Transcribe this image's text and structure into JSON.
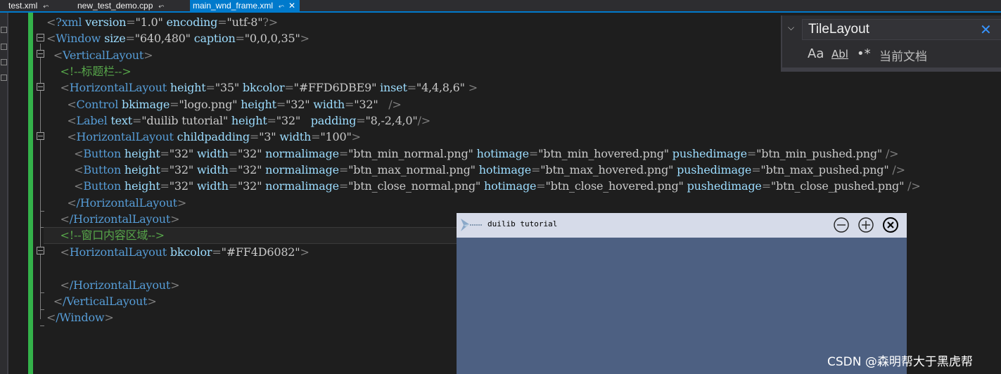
{
  "tabs": [
    {
      "label": "test.xml",
      "pin": "⬿",
      "active": false
    },
    {
      "label": "new_test_demo.cpp",
      "pin": "⬿",
      "active": false
    },
    {
      "label": "main_wnd_frame.xml",
      "pin": "⬿",
      "close": "✕",
      "active": true
    }
  ],
  "code": {
    "xml_decl": {
      "tag": "?xml",
      "a1": "version",
      "v1": "\"1.0\"",
      "a2": "encoding",
      "v2": "\"utf-8\"",
      "end": "?>"
    },
    "window": {
      "tag": "Window",
      "a1": "size",
      "v1": "\"640,480\"",
      "a2": "caption",
      "v2": "\"0,0,0,35\""
    },
    "vlayout_open": "VerticalLayout",
    "comment_title": "<!--标题栏-->",
    "hl_title": {
      "tag": "HorizontalLayout",
      "a1": "height",
      "v1": "\"35\"",
      "a2": "bkcolor",
      "v2": "\"#FFD6DBE9\"",
      "a3": "inset",
      "v3": "\"4,4,8,6\""
    },
    "control": {
      "tag": "Control",
      "a1": "bkimage",
      "v1": "\"logo.png\"",
      "a2": "height",
      "v2": "\"32\"",
      "a3": "width",
      "v3": "\"32\""
    },
    "label": {
      "tag": "Label",
      "a1": "text",
      "v1": "\"duilib tutorial\"",
      "a2": "height",
      "v2": "\"32\"",
      "a3": "padding",
      "v3": "\"8,-2,4,0\""
    },
    "hl_buttons": {
      "tag": "HorizontalLayout",
      "a1": "childpadding",
      "v1": "\"3\"",
      "a2": "width",
      "v2": "\"100\""
    },
    "btn_min": {
      "tag": "Button",
      "a1": "height",
      "v1": "\"32\"",
      "a2": "width",
      "v2": "\"32\"",
      "a3": "normalimage",
      "v3": "\"btn_min_normal.png\"",
      "a4": "hotimage",
      "v4": "\"btn_min_hovered.png\"",
      "a5": "pushedimage",
      "v5": "\"btn_min_pushed.png\""
    },
    "btn_max": {
      "tag": "Button",
      "a1": "height",
      "v1": "\"32\"",
      "a2": "width",
      "v2": "\"32\"",
      "a3": "normalimage",
      "v3": "\"btn_max_normal.png\"",
      "a4": "hotimage",
      "v4": "\"btn_max_hovered.png\"",
      "a5": "pushedimage",
      "v5": "\"btn_max_pushed.png\""
    },
    "btn_close": {
      "tag": "Button",
      "a1": "height",
      "v1": "\"32\"",
      "a2": "width",
      "v2": "\"32\"",
      "a3": "normalimage",
      "v3": "\"btn_close_normal.png\"",
      "a4": "hotimage",
      "v4": "\"btn_close_hovered.png\"",
      "a5": "pushedimage",
      "v5": "\"btn_close_pushed.png\""
    },
    "hl_close_tag": "/HorizontalLayout",
    "comment_content": "<!--窗口内容区域-->",
    "hl_content": {
      "tag": "HorizontalLayout",
      "a1": "bkcolor",
      "v1": "\"#FF4D6082\""
    },
    "vlayout_close": "/VerticalLayout",
    "window_close": "/Window"
  },
  "find": {
    "query": "TileLayout",
    "match_case": "Aa",
    "whole_word": "Abl",
    "regex": "•*",
    "scope": "当前文档"
  },
  "preview": {
    "caption": "duilib tutorial",
    "title_color": "#d6dbe9",
    "body_color": "#4d6082"
  },
  "watermark": "CSDN @森明帮大于黑虎帮"
}
